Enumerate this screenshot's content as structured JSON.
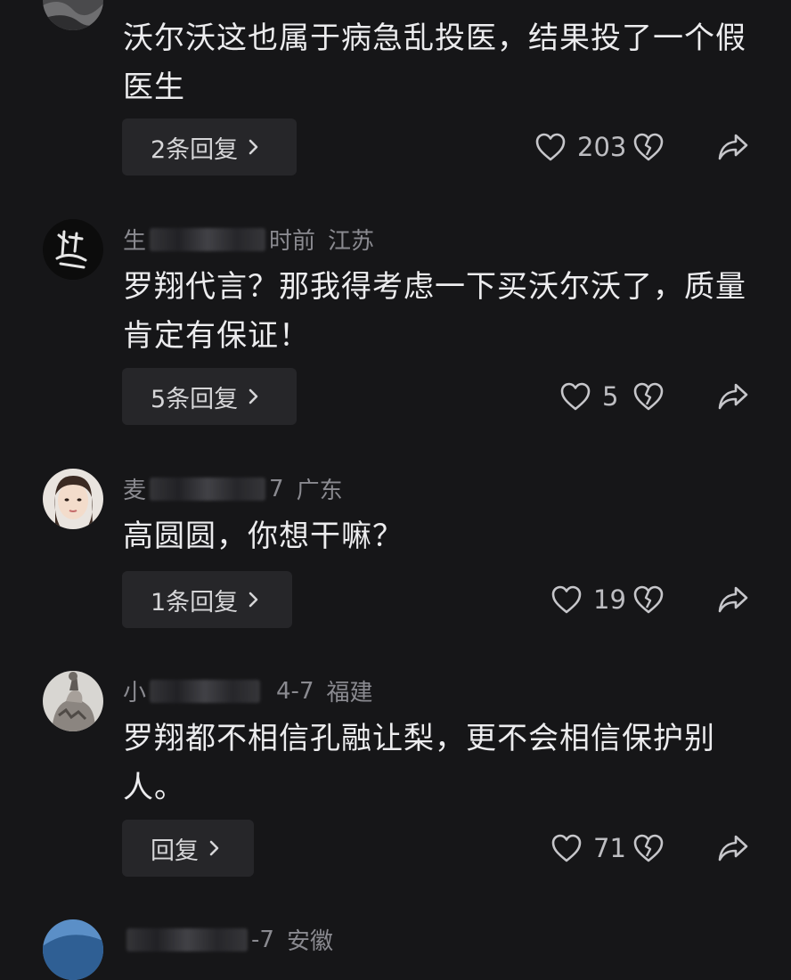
{
  "comments": [
    {
      "meta_name": "",
      "meta_time": "",
      "meta_location": "",
      "text": "沃尔沃这也属于病急乱投医，结果投了一个假医生",
      "reply_label": "2条回复",
      "likes": "203"
    },
    {
      "meta_name": "生",
      "meta_time": "时前",
      "meta_location": "江苏",
      "avatar_text": "道",
      "text": "罗翔代言？那我得考虑一下买沃尔沃了，质量肯定有保证！",
      "reply_label": "5条回复",
      "likes": "5"
    },
    {
      "meta_name": "麦",
      "meta_time": "7",
      "meta_location": "广东",
      "text": "高圆圆，你想干嘛？",
      "reply_label": "1条回复",
      "likes": "19"
    },
    {
      "meta_name": "小",
      "meta_time": "4-7",
      "meta_location": "福建",
      "text": "罗翔都不相信孔融让梨，更不会相信保护别人。",
      "reply_label": "回复",
      "likes": "71"
    },
    {
      "meta_name": "",
      "meta_time": "-7",
      "meta_location": "安徽"
    }
  ],
  "icons": {
    "like": "heart-outline-icon",
    "dislike": "broken-heart-icon",
    "share": "share-arrow-icon",
    "chevron": "chevron-right-icon"
  },
  "colors": {
    "background": "#161618",
    "reply_button": "#262629",
    "meta_text": "#8a8a90",
    "body_text": "#ececee"
  }
}
